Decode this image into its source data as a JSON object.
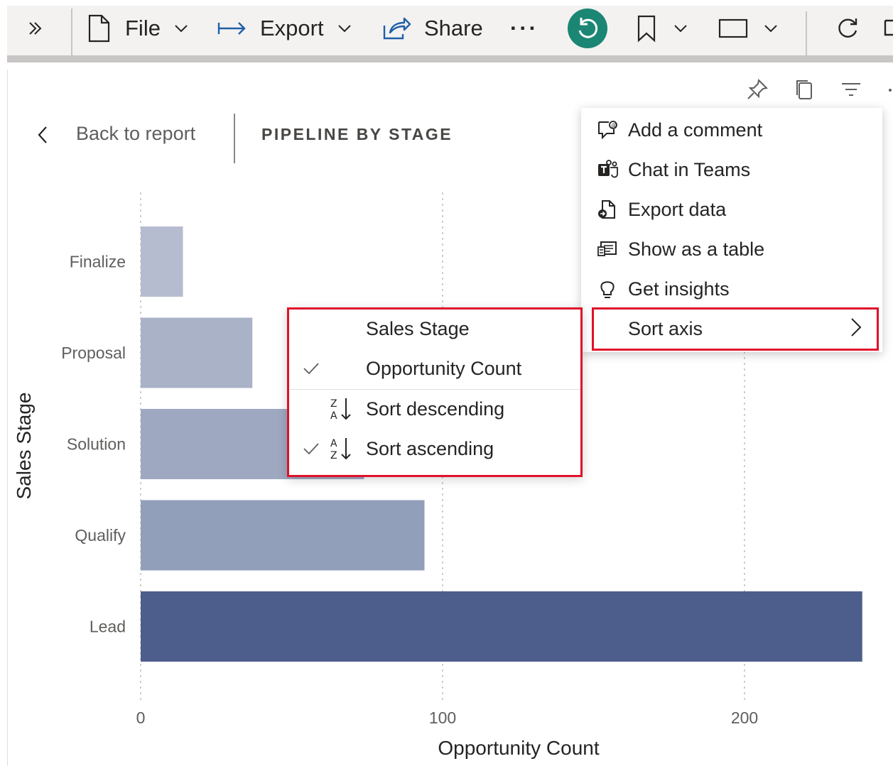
{
  "toolbar": {
    "expand_icon": "double-chevron-right-icon",
    "file_label": "File",
    "export_label": "Export",
    "share_label": "Share",
    "more_label": "···",
    "reset_icon": "reset-icon",
    "reset_color": "#1b8673",
    "bookmark_icon": "bookmark-icon",
    "view_icon": "view-icon",
    "refresh_icon": "refresh-icon"
  },
  "visual_header": {
    "pin_icon": "pin-icon",
    "copy_icon": "copy-icon",
    "filter_icon": "filter-icon"
  },
  "focus": {
    "back_label": "Back to report",
    "title": "PIPELINE BY STAGE"
  },
  "chart_data": {
    "type": "bar",
    "orientation": "horizontal",
    "categories": [
      "Finalize",
      "Proposal",
      "Solution",
      "Qualify",
      "Lead"
    ],
    "values": [
      14,
      37,
      74,
      94,
      239
    ],
    "colors": [
      "#b6bccf",
      "#aab2c8",
      "#9ea8c0",
      "#929fba",
      "#4e5e8c"
    ],
    "xlabel": "Opportunity Count",
    "ylabel": "Sales Stage",
    "xlim": [
      0,
      240
    ],
    "xticks": [
      "0",
      "100",
      "200"
    ],
    "grid": "vertical dotted"
  },
  "context_menu": {
    "items": [
      {
        "label": "Add a comment",
        "icon": "comment-icon"
      },
      {
        "label": "Chat in Teams",
        "icon": "teams-icon"
      },
      {
        "label": "Export data",
        "icon": "export-data-icon"
      },
      {
        "label": "Show as a table",
        "icon": "table-icon"
      },
      {
        "label": "Get insights",
        "icon": "lightbulb-icon"
      },
      {
        "label": "Sort axis",
        "icon": "",
        "has_submenu": true
      }
    ],
    "highlight_color": "#e0112b"
  },
  "sort_submenu": {
    "items": [
      {
        "label": "Sales Stage",
        "checked": false
      },
      {
        "label": "Opportunity Count",
        "checked": true
      },
      {
        "label": "Sort descending",
        "checked": false,
        "icon": "sort-za-icon"
      },
      {
        "label": "Sort ascending",
        "checked": true,
        "icon": "sort-az-icon"
      }
    ]
  }
}
